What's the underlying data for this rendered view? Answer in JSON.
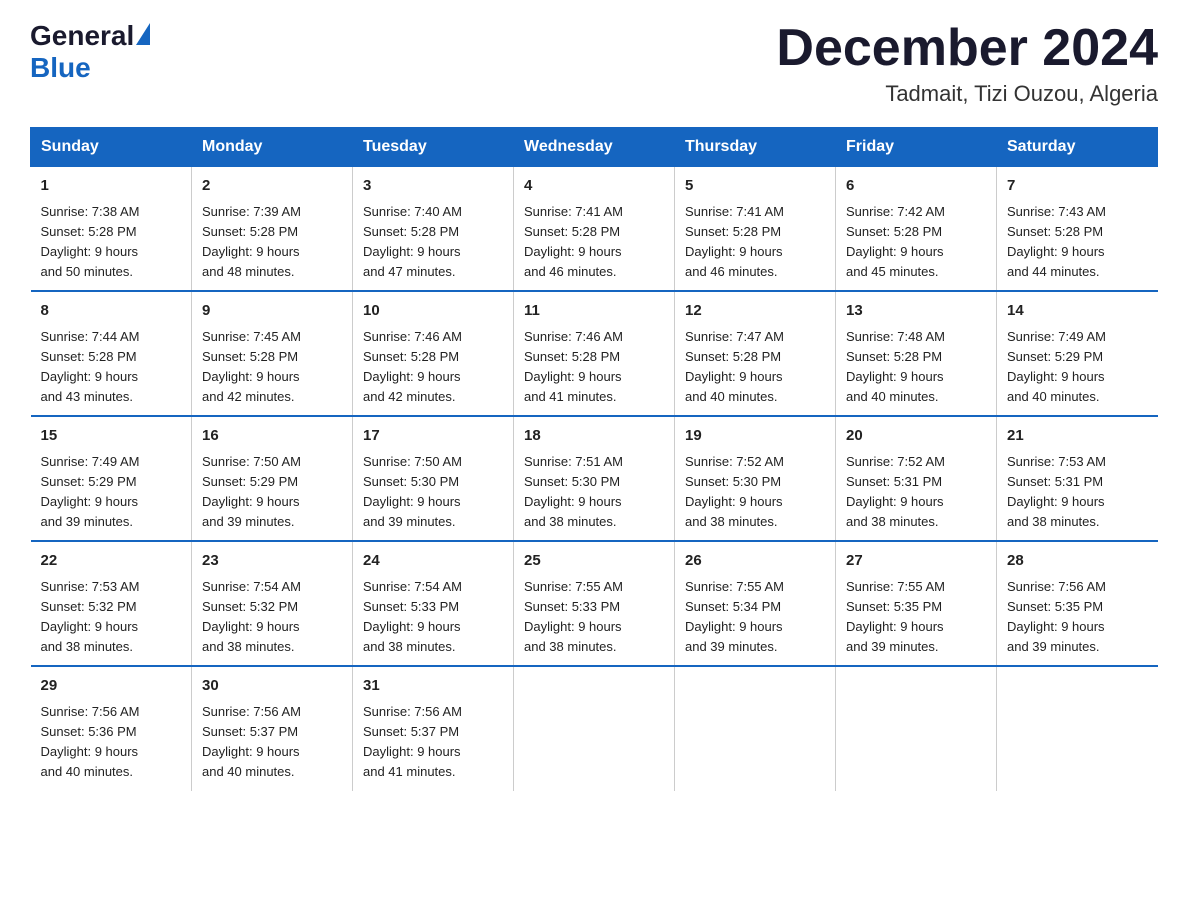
{
  "logo": {
    "general": "General",
    "blue": "Blue"
  },
  "header": {
    "month": "December 2024",
    "location": "Tadmait, Tizi Ouzou, Algeria"
  },
  "weekdays": [
    "Sunday",
    "Monday",
    "Tuesday",
    "Wednesday",
    "Thursday",
    "Friday",
    "Saturday"
  ],
  "weeks": [
    [
      {
        "day": "1",
        "sunrise": "7:38 AM",
        "sunset": "5:28 PM",
        "daylight": "9 hours and 50 minutes."
      },
      {
        "day": "2",
        "sunrise": "7:39 AM",
        "sunset": "5:28 PM",
        "daylight": "9 hours and 48 minutes."
      },
      {
        "day": "3",
        "sunrise": "7:40 AM",
        "sunset": "5:28 PM",
        "daylight": "9 hours and 47 minutes."
      },
      {
        "day": "4",
        "sunrise": "7:41 AM",
        "sunset": "5:28 PM",
        "daylight": "9 hours and 46 minutes."
      },
      {
        "day": "5",
        "sunrise": "7:41 AM",
        "sunset": "5:28 PM",
        "daylight": "9 hours and 46 minutes."
      },
      {
        "day": "6",
        "sunrise": "7:42 AM",
        "sunset": "5:28 PM",
        "daylight": "9 hours and 45 minutes."
      },
      {
        "day": "7",
        "sunrise": "7:43 AM",
        "sunset": "5:28 PM",
        "daylight": "9 hours and 44 minutes."
      }
    ],
    [
      {
        "day": "8",
        "sunrise": "7:44 AM",
        "sunset": "5:28 PM",
        "daylight": "9 hours and 43 minutes."
      },
      {
        "day": "9",
        "sunrise": "7:45 AM",
        "sunset": "5:28 PM",
        "daylight": "9 hours and 42 minutes."
      },
      {
        "day": "10",
        "sunrise": "7:46 AM",
        "sunset": "5:28 PM",
        "daylight": "9 hours and 42 minutes."
      },
      {
        "day": "11",
        "sunrise": "7:46 AM",
        "sunset": "5:28 PM",
        "daylight": "9 hours and 41 minutes."
      },
      {
        "day": "12",
        "sunrise": "7:47 AM",
        "sunset": "5:28 PM",
        "daylight": "9 hours and 40 minutes."
      },
      {
        "day": "13",
        "sunrise": "7:48 AM",
        "sunset": "5:28 PM",
        "daylight": "9 hours and 40 minutes."
      },
      {
        "day": "14",
        "sunrise": "7:49 AM",
        "sunset": "5:29 PM",
        "daylight": "9 hours and 40 minutes."
      }
    ],
    [
      {
        "day": "15",
        "sunrise": "7:49 AM",
        "sunset": "5:29 PM",
        "daylight": "9 hours and 39 minutes."
      },
      {
        "day": "16",
        "sunrise": "7:50 AM",
        "sunset": "5:29 PM",
        "daylight": "9 hours and 39 minutes."
      },
      {
        "day": "17",
        "sunrise": "7:50 AM",
        "sunset": "5:30 PM",
        "daylight": "9 hours and 39 minutes."
      },
      {
        "day": "18",
        "sunrise": "7:51 AM",
        "sunset": "5:30 PM",
        "daylight": "9 hours and 38 minutes."
      },
      {
        "day": "19",
        "sunrise": "7:52 AM",
        "sunset": "5:30 PM",
        "daylight": "9 hours and 38 minutes."
      },
      {
        "day": "20",
        "sunrise": "7:52 AM",
        "sunset": "5:31 PM",
        "daylight": "9 hours and 38 minutes."
      },
      {
        "day": "21",
        "sunrise": "7:53 AM",
        "sunset": "5:31 PM",
        "daylight": "9 hours and 38 minutes."
      }
    ],
    [
      {
        "day": "22",
        "sunrise": "7:53 AM",
        "sunset": "5:32 PM",
        "daylight": "9 hours and 38 minutes."
      },
      {
        "day": "23",
        "sunrise": "7:54 AM",
        "sunset": "5:32 PM",
        "daylight": "9 hours and 38 minutes."
      },
      {
        "day": "24",
        "sunrise": "7:54 AM",
        "sunset": "5:33 PM",
        "daylight": "9 hours and 38 minutes."
      },
      {
        "day": "25",
        "sunrise": "7:55 AM",
        "sunset": "5:33 PM",
        "daylight": "9 hours and 38 minutes."
      },
      {
        "day": "26",
        "sunrise": "7:55 AM",
        "sunset": "5:34 PM",
        "daylight": "9 hours and 39 minutes."
      },
      {
        "day": "27",
        "sunrise": "7:55 AM",
        "sunset": "5:35 PM",
        "daylight": "9 hours and 39 minutes."
      },
      {
        "day": "28",
        "sunrise": "7:56 AM",
        "sunset": "5:35 PM",
        "daylight": "9 hours and 39 minutes."
      }
    ],
    [
      {
        "day": "29",
        "sunrise": "7:56 AM",
        "sunset": "5:36 PM",
        "daylight": "9 hours and 40 minutes."
      },
      {
        "day": "30",
        "sunrise": "7:56 AM",
        "sunset": "5:37 PM",
        "daylight": "9 hours and 40 minutes."
      },
      {
        "day": "31",
        "sunrise": "7:56 AM",
        "sunset": "5:37 PM",
        "daylight": "9 hours and 41 minutes."
      },
      null,
      null,
      null,
      null
    ]
  ]
}
